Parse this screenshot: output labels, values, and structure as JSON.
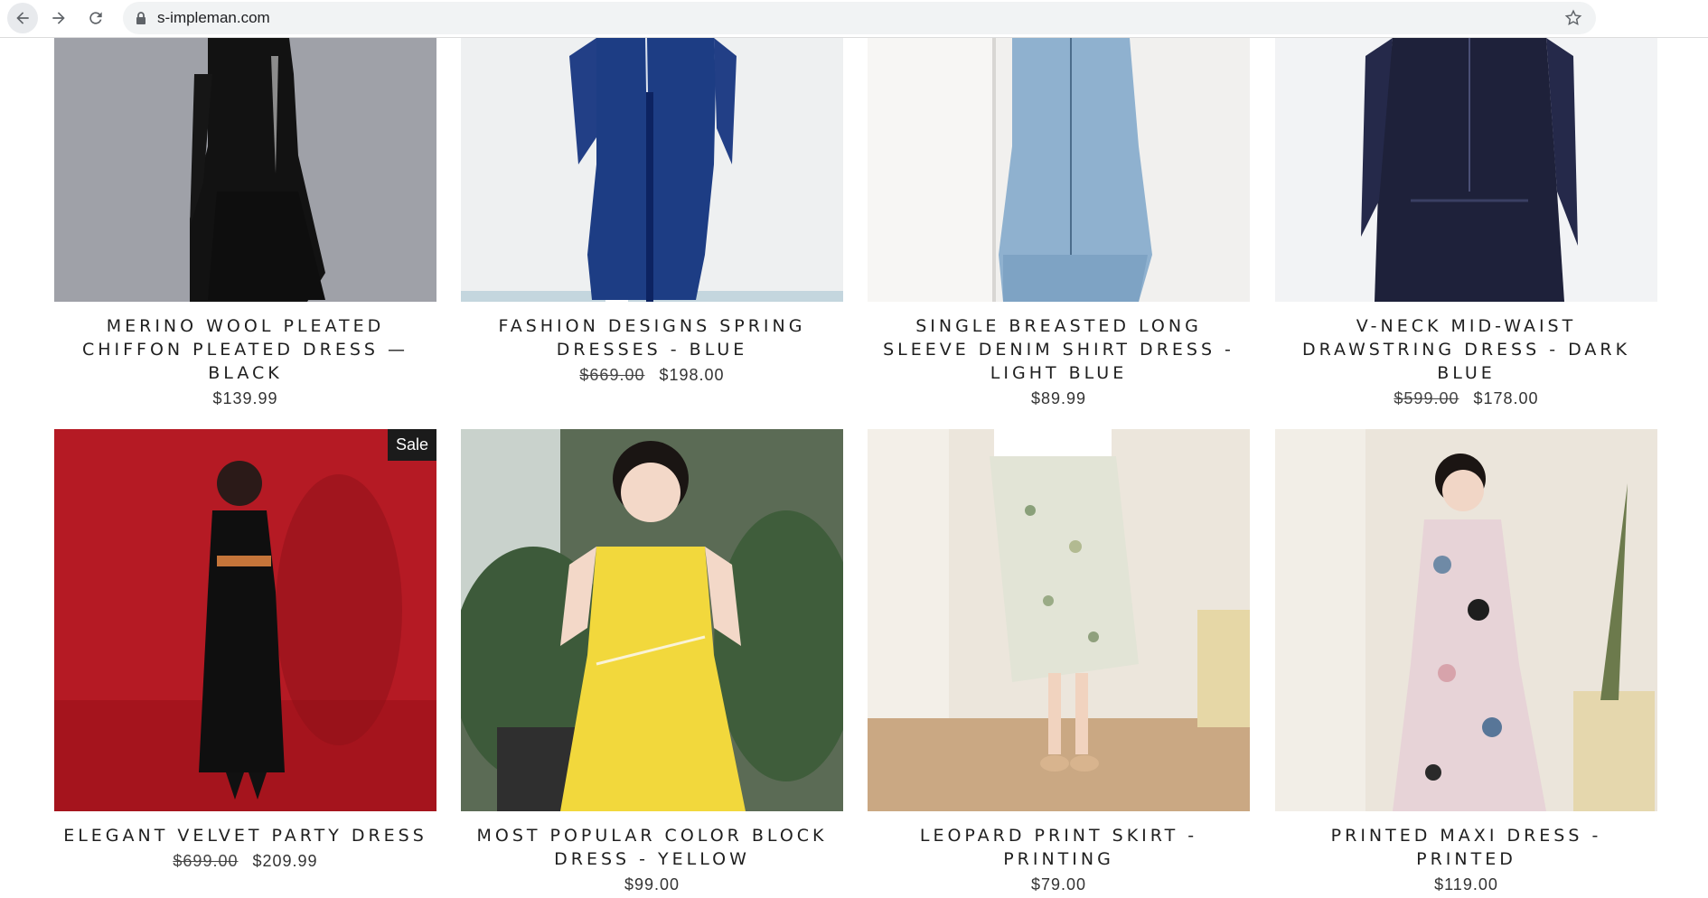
{
  "browser": {
    "url": "s-impleman.com"
  },
  "products": [
    {
      "title": "MERINO WOOL PLEATED CHIFFON PLEATED DRESS — BLACK",
      "old_price": "",
      "price": "$139.99",
      "badge": ""
    },
    {
      "title": "FASHION DESIGNS SPRING DRESSES - BLUE",
      "old_price": "$669.00",
      "price": "$198.00",
      "badge": ""
    },
    {
      "title": "SINGLE BREASTED LONG SLEEVE DENIM SHIRT DRESS - LIGHT BLUE",
      "old_price": "",
      "price": "$89.99",
      "badge": ""
    },
    {
      "title": "V-NECK MID-WAIST DRAWSTRING DRESS - DARK BLUE",
      "old_price": "$599.00",
      "price": "$178.00",
      "badge": ""
    },
    {
      "title": "ELEGANT VELVET PARTY DRESS",
      "old_price": "$699.00",
      "price": "$209.99",
      "badge": "Sale"
    },
    {
      "title": "MOST POPULAR COLOR BLOCK DRESS - YELLOW",
      "old_price": "",
      "price": "$99.00",
      "badge": ""
    },
    {
      "title": "LEOPARD PRINT SKIRT - PRINTING",
      "old_price": "",
      "price": "$79.00",
      "badge": ""
    },
    {
      "title": "PRINTED MAXI DRESS - PRINTED",
      "old_price": "",
      "price": "$119.00",
      "badge": ""
    }
  ],
  "icons": {
    "back": "arrow-left-icon",
    "forward": "arrow-right-icon",
    "reload": "reload-icon",
    "lock": "lock-icon",
    "bookmark": "star-icon"
  }
}
